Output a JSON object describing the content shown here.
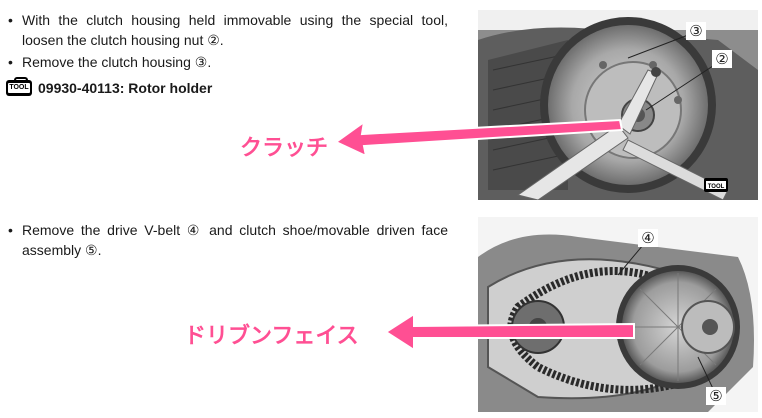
{
  "steps": [
    {
      "bullet": "•",
      "text": "With the clutch housing held immovable using the special tool, loosen the clutch housing nut ②."
    },
    {
      "bullet": "•",
      "text": "Remove the clutch housing ③."
    },
    {
      "bullet": "•",
      "text": "Remove the drive V-belt ④ and clutch shoe/movable driven face assembly ⑤."
    }
  ],
  "tool": {
    "icon": "tool-icon",
    "icon_text": "TOOL",
    "label": "09930-40113: Rotor holder"
  },
  "photo1": {
    "callouts": [
      "③",
      "②"
    ],
    "tool_badge": "TOOL"
  },
  "photo2": {
    "callouts": [
      "④",
      "⑤"
    ]
  },
  "annotations": {
    "clutch": "クラッチ",
    "driven_face": "ドリブンフェイス",
    "color": "#ff4f93"
  }
}
